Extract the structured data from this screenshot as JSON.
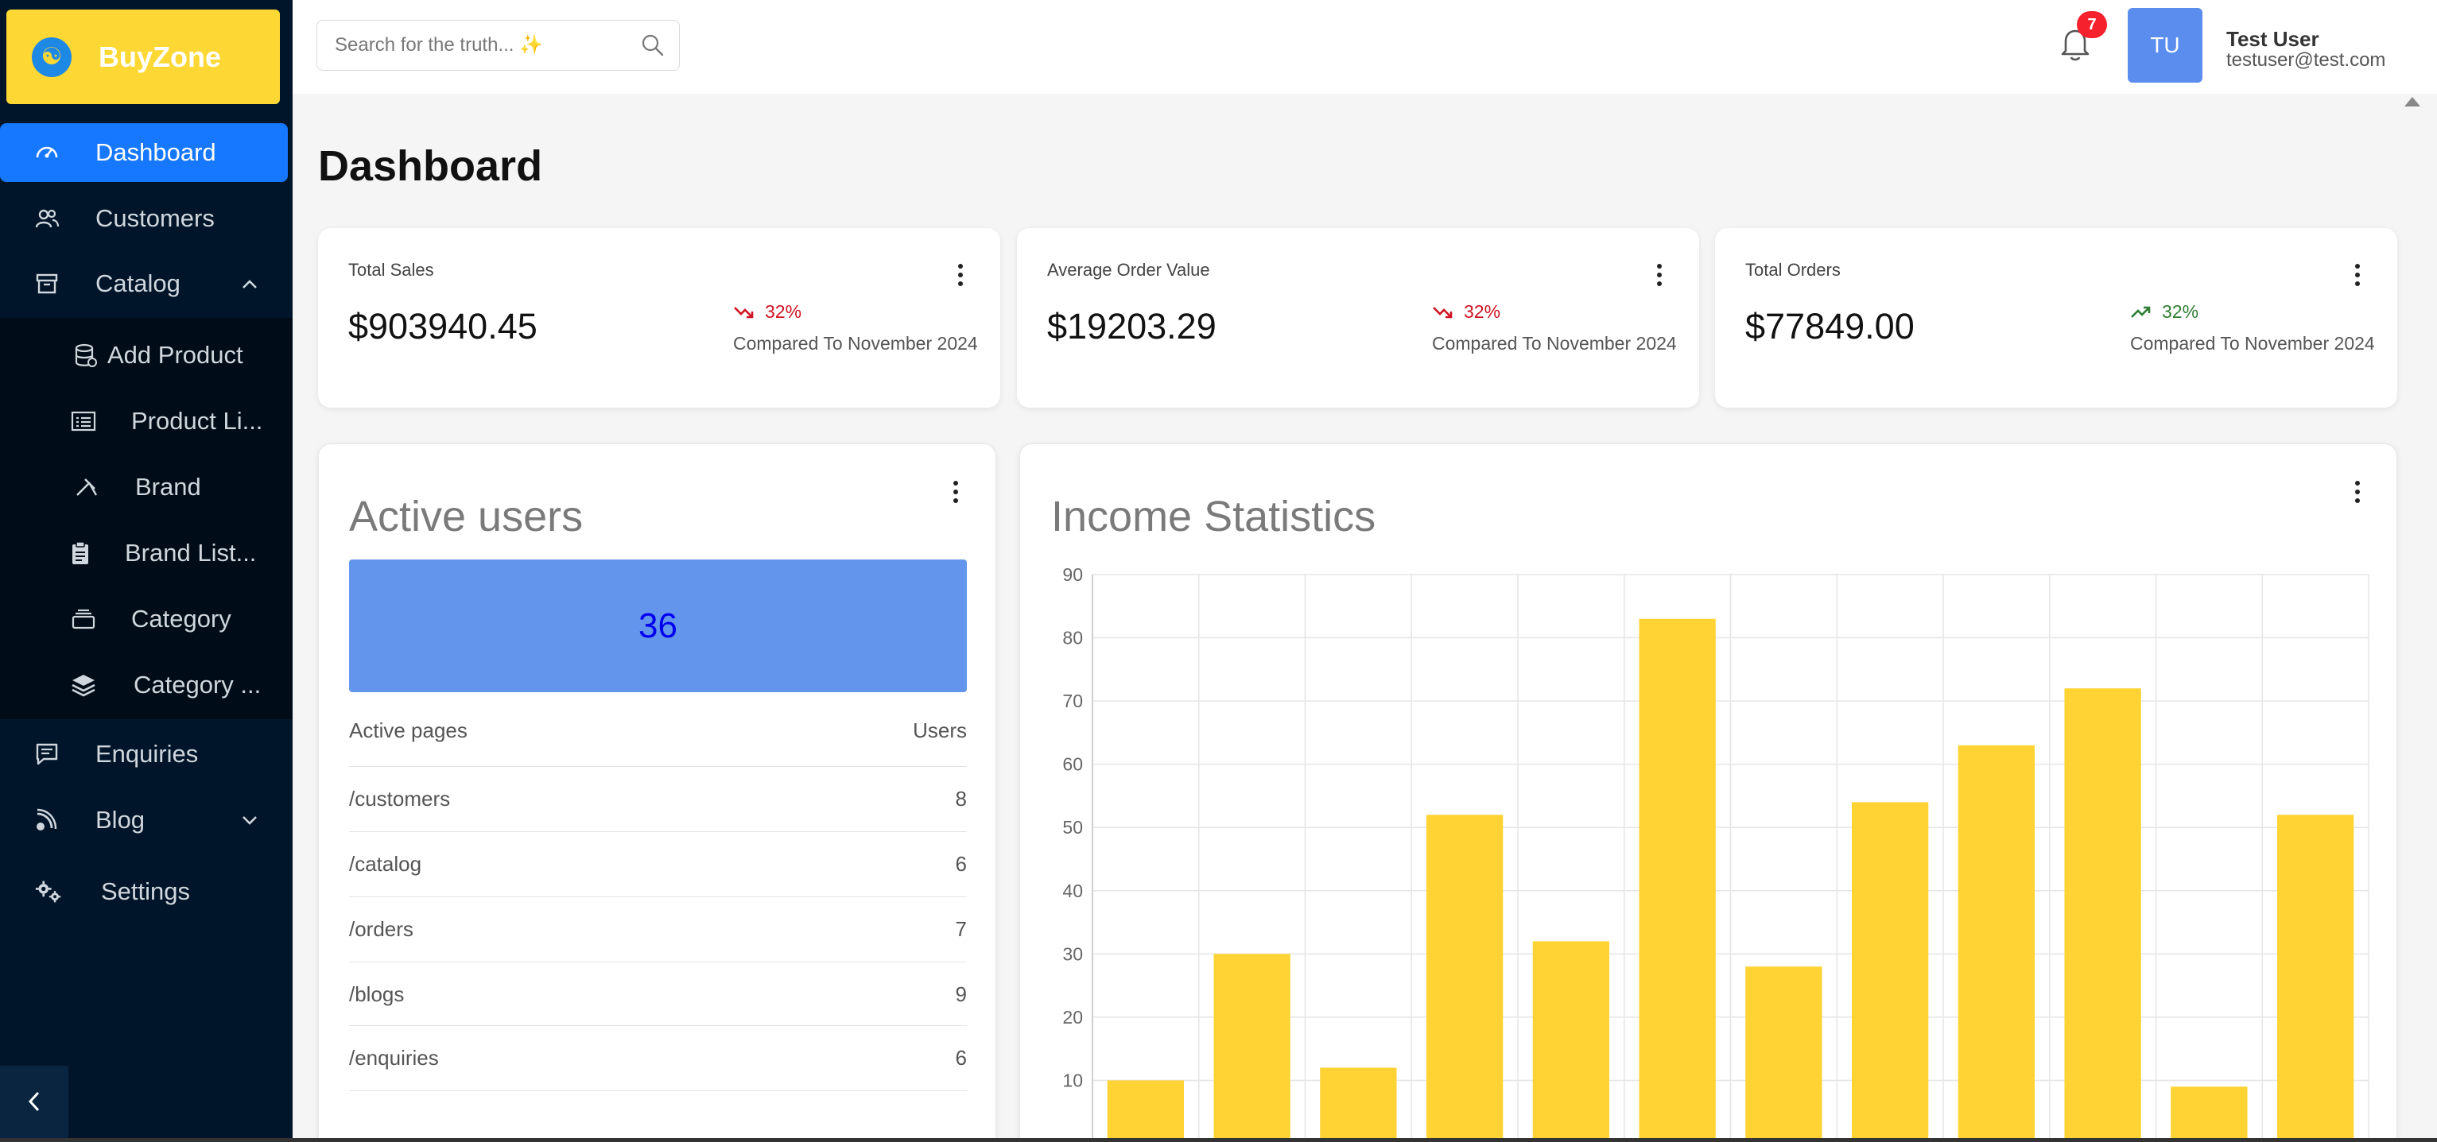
{
  "brand": {
    "name": "BuyZone",
    "logo_glyph": "☯"
  },
  "sidebar": {
    "items": [
      {
        "label": "Dashboard",
        "icon": "dashboard-icon",
        "active": true
      },
      {
        "label": "Customers",
        "icon": "users-icon"
      },
      {
        "label": "Catalog",
        "icon": "archive-icon",
        "expanded": true
      },
      {
        "label": "Enquiries",
        "icon": "message-icon"
      },
      {
        "label": "Blog",
        "icon": "blog-icon",
        "expanded": false
      },
      {
        "label": "Settings",
        "icon": "settings-icon"
      }
    ],
    "catalog_children": [
      {
        "label": "Add Product",
        "icon": "database-icon"
      },
      {
        "label": "Product Li...",
        "icon": "list-icon"
      },
      {
        "label": "Brand",
        "icon": "brand-icon"
      },
      {
        "label": "Brand List...",
        "icon": "clipboard-icon"
      },
      {
        "label": "Category",
        "icon": "layers-icon"
      },
      {
        "label": "Category ...",
        "icon": "stack-icon"
      }
    ],
    "collapse_glyph": "<"
  },
  "header": {
    "search_placeholder": "Search for the truth... ✨",
    "notification_count": "7",
    "avatar_initials": "TU",
    "user_name": "Test User",
    "user_email": "testuser@test.com"
  },
  "page": {
    "title": "Dashboard"
  },
  "stats": [
    {
      "title": "Total Sales",
      "value": "$903940.45",
      "trend": "32%",
      "direction": "down",
      "compare": "Compared To November 2024"
    },
    {
      "title": "Average Order Value",
      "value": "$19203.29",
      "trend": "32%",
      "direction": "down",
      "compare": "Compared To November 2024"
    },
    {
      "title": "Total Orders",
      "value": "$77849.00",
      "trend": "32%",
      "direction": "up",
      "compare": "Compared To November 2024"
    }
  ],
  "colors": {
    "trend_down": "#cf1322",
    "trend_up": "#2e7d32",
    "accent": "#1677ff",
    "brand_yellow": "#fdd835",
    "bar": "#ffd333"
  },
  "active_users": {
    "title": "Active users",
    "count": "36",
    "table_headers": [
      "Active pages",
      "Users"
    ],
    "rows": [
      {
        "page": "/customers",
        "users": "8"
      },
      {
        "page": "/catalog",
        "users": "6"
      },
      {
        "page": "/orders",
        "users": "7"
      },
      {
        "page": "/blogs",
        "users": "9"
      },
      {
        "page": "/enquiries",
        "users": "6"
      }
    ]
  },
  "income": {
    "title": "Income Statistics"
  },
  "chart_data": {
    "type": "bar",
    "title": "Income Statistics",
    "values": [
      10,
      30,
      12,
      52,
      32,
      83,
      28,
      54,
      63,
      72,
      9,
      52
    ],
    "y_ticks": [
      10,
      20,
      30,
      40,
      50,
      60,
      70,
      80,
      90
    ],
    "ylim": [
      0,
      90
    ],
    "grid": true,
    "color": "#ffd333"
  }
}
